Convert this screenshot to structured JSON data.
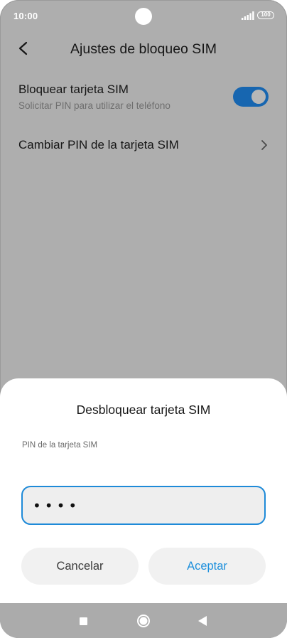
{
  "status_bar": {
    "time": "10:00",
    "battery": "100"
  },
  "header": {
    "title": "Ajustes de bloqueo SIM",
    "back_icon": "back-arrow-icon"
  },
  "settings": {
    "lock_sim": {
      "title": "Bloquear tarjeta SIM",
      "subtitle": "Solicitar PIN para utilizar el teléfono",
      "enabled": true
    },
    "change_pin": {
      "title": "Cambiar PIN de la tarjeta SIM",
      "icon": "chevron-right-icon"
    }
  },
  "dialog": {
    "title": "Desbloquear tarjeta SIM",
    "field_label": "PIN de la tarjeta SIM",
    "pin_value": "••••",
    "cancel_label": "Cancelar",
    "accept_label": "Aceptar"
  },
  "colors": {
    "toggle_on": "#1766b0",
    "accent": "#1e90dc",
    "overlay_bg": "#aeaeae"
  }
}
